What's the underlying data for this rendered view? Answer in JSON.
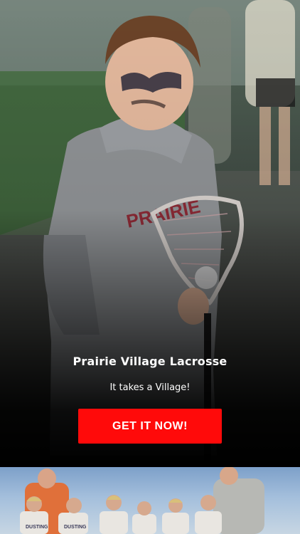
{
  "app": {
    "title": "Prairie Village Lacrosse",
    "tagline": "It takes a Village!",
    "cta_label": "GET IT NOW!"
  },
  "hero": {
    "photo": "boy-with-lacrosse-stick-photo",
    "hoodie_print": "PRAIRIE"
  },
  "preview": {
    "photo": "team-group-photo",
    "jersey_print": "DUSTING"
  },
  "colors": {
    "cta_background": "#ff0a0a",
    "text": "#ffffff",
    "background": "#000000"
  }
}
